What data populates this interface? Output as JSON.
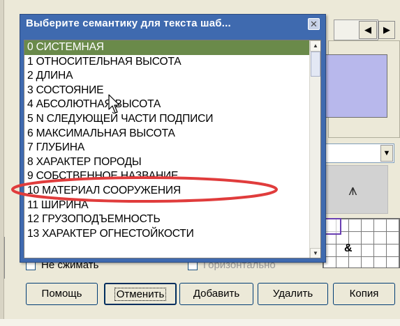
{
  "popup": {
    "title": "Выберите семантику для текста шаб...",
    "close_glyph": "✕",
    "items": [
      {
        "label": "0 СИСТЕМНАЯ",
        "selected": true
      },
      {
        "label": "1 ОТНОСИТЕЛЬНАЯ ВЫСОТА"
      },
      {
        "label": "2 ДЛИНА"
      },
      {
        "label": "3 СОСТОЯНИЕ"
      },
      {
        "label": "4 АБСОЛЮТНАЯ ВЫСОТА"
      },
      {
        "label": "5 N СЛЕДУЮЩЕЙ ЧАСТИ ПОДПИСИ"
      },
      {
        "label": "6 МАКСИМАЛЬНАЯ ВЫСОТА"
      },
      {
        "label": "7 ГЛУБИНА"
      },
      {
        "label": "8 ХАРАКТЕР ПОРОДЫ"
      },
      {
        "label": "9 СОБСТВЕННОЕ НАЗВАНИЕ"
      },
      {
        "label": "10 МАТЕРИАЛ СООРУЖЕНИЯ"
      },
      {
        "label": "11 ШИРИНА"
      },
      {
        "label": "12 ГРУЗОПОДЪЕМНОСТЬ"
      },
      {
        "label": "13 ХАРАКТЕР ОГНЕСТОЙКОСТИ"
      }
    ]
  },
  "dialog": {
    "checkbox_label": "Не сжимать",
    "checkbox2_label": "Горизонтально",
    "buttons": {
      "help": "Помощь",
      "cancel": "Отменить",
      "add": "Добавить",
      "delete": "Удалить",
      "copy": "Копия"
    },
    "amp": "&",
    "symbol": "⩚",
    "arrow_left": "◀",
    "arrow_right": "▶",
    "combo_arrow": "▼"
  },
  "colors": {
    "title_bar": "#3f6aaf",
    "selection": "#6a8a4a",
    "annotation": "#e03c3c",
    "preview_fill": "#b8b8ec"
  },
  "icons": [
    "close-icon",
    "scroll-up-icon",
    "scroll-down-icon",
    "arrow-left-icon",
    "arrow-right-icon",
    "chevron-down-icon",
    "mouse-cursor-icon",
    "tree-symbol-icon"
  ]
}
